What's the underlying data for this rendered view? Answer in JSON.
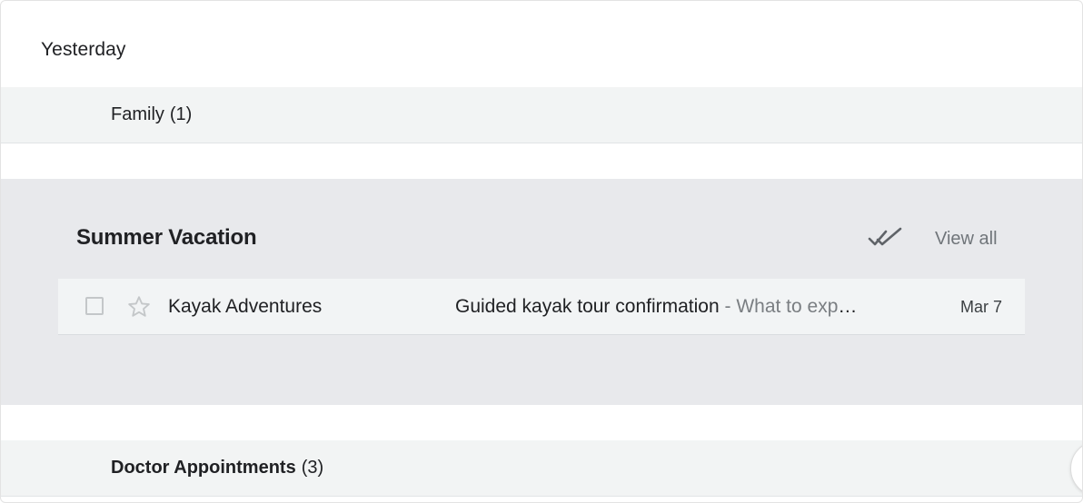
{
  "section": {
    "label": "Yesterday"
  },
  "bundles": {
    "family": {
      "name": "Family",
      "count": "(1)"
    },
    "doctor": {
      "name": "Doctor Appointments",
      "count": "(3)"
    }
  },
  "expanded_bundle": {
    "title": "Summer Vacation",
    "mark_read_icon": "double-check-icon",
    "view_all_label": "View all",
    "email": {
      "sender": "Kayak Adventures",
      "subject": "Guided kayak tour confirmation",
      "snippet": " - What to expect on your tour",
      "date": "Mar 7"
    }
  },
  "colors": {
    "bundle_bg": "#f2f4f4",
    "expanded_bg": "#e8e9ec",
    "muted_text": "#70757a"
  }
}
